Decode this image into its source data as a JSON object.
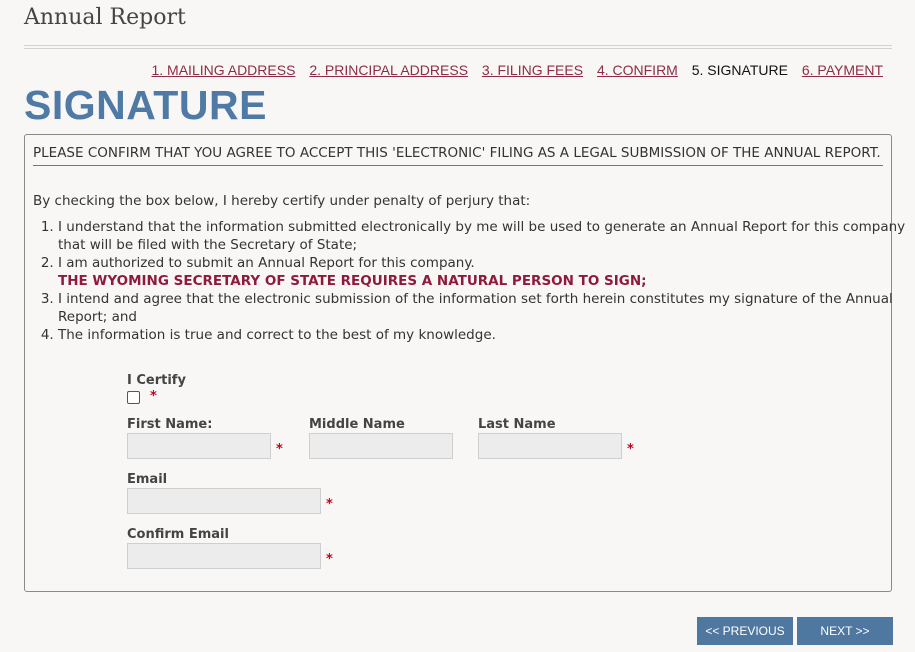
{
  "page": {
    "title": "Annual Report"
  },
  "steps": [
    {
      "label": "1. MAILING ADDRESS"
    },
    {
      "label": "2. PRINCIPAL ADDRESS"
    },
    {
      "label": "3. FILING FEES"
    },
    {
      "label": "4. CONFIRM"
    },
    {
      "label": "5. SIGNATURE"
    },
    {
      "label": "6. PAYMENT"
    }
  ],
  "heading": "SIGNATURE",
  "confirm_text": "PLEASE CONFIRM THAT YOU AGREE TO ACCEPT THIS 'ELECTRONIC' FILING AS A LEGAL SUBMISSION OF THE ANNUAL REPORT.",
  "intro": "By checking the box below, I hereby certify under penalty of perjury that:",
  "certifications": [
    "I understand that the information submitted electronically by me will be used to generate an Annual Report for this company that will be filed with the Secretary of State;",
    "I am authorized to submit an Annual Report for this company.",
    "I intend and agree that the electronic submission of the information set forth herein constitutes my signature of the Annual Report; and",
    "The information is true and correct to the best of my knowledge."
  ],
  "warning": "THE WYOMING SECRETARY OF STATE REQUIRES A NATURAL PERSON TO SIGN;",
  "form": {
    "certify_label": "I Certify",
    "required_marker": "*",
    "first_name_label": "First Name:",
    "middle_name_label": "Middle Name",
    "last_name_label": "Last Name",
    "email_label": "Email",
    "confirm_email_label": "Confirm Email",
    "first_name_value": "",
    "middle_name_value": "",
    "last_name_value": "",
    "email_value": "",
    "confirm_email_value": ""
  },
  "buttons": {
    "previous": "<< PREVIOUS",
    "next": "NEXT >>"
  },
  "colors": {
    "accent": "#4e7aa5",
    "link": "#8e2c48",
    "warning": "#8e1b3d",
    "required": "#c4001a"
  }
}
